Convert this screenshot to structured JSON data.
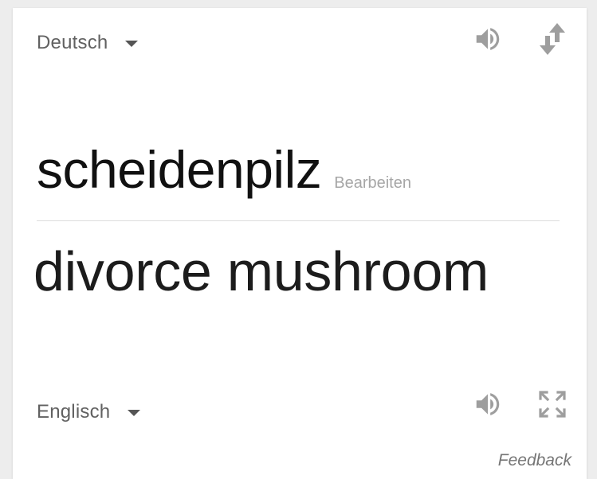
{
  "source": {
    "language": "Deutsch",
    "text": "scheidenpilz",
    "edit_label": "Bearbeiten"
  },
  "target": {
    "language": "Englisch",
    "text": "divorce mushroom"
  },
  "footer": {
    "feedback_label": "Feedback"
  },
  "icons": {
    "source_speaker": "speaker-icon",
    "swap": "swap-languages-icon",
    "target_speaker": "speaker-icon",
    "expand": "fullscreen-icon",
    "dropdown": "caret-down-icon"
  },
  "colors": {
    "card_background": "#ffffff",
    "page_background": "#ededed",
    "primary_text": "#111111",
    "secondary_text": "#616161",
    "muted_text": "#a6a6a6",
    "icon_gray": "#9e9e9e"
  }
}
